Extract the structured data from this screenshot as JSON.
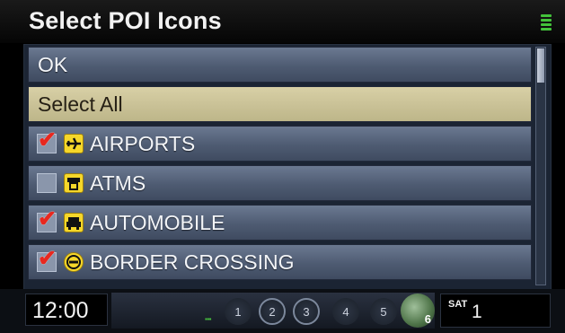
{
  "header": {
    "title": "Select POI Icons",
    "signal_icon": "signal-strength-icon"
  },
  "list": {
    "ok_label": "OK",
    "select_all_label": "Select All",
    "items": [
      {
        "label": "AIRPORTS",
        "checked": true,
        "icon": "airplane-icon"
      },
      {
        "label": "ATMS",
        "checked": false,
        "icon": "atm-icon"
      },
      {
        "label": "AUTOMOBILE",
        "checked": true,
        "icon": "car-icon"
      },
      {
        "label": "BORDER CROSSING",
        "checked": true,
        "icon": "border-crossing-icon"
      }
    ]
  },
  "status_bar": {
    "clock": "12:00",
    "presets": [
      "1",
      "2",
      "3",
      "4",
      "5"
    ],
    "disc_number": "6",
    "source": "SAT",
    "channel": "1"
  },
  "colors": {
    "row": "#56637b",
    "row_selected": "#ccc49a",
    "check": "#e8281f",
    "poi_icon_bg": "#f6d72a",
    "signal": "#43c23a"
  }
}
